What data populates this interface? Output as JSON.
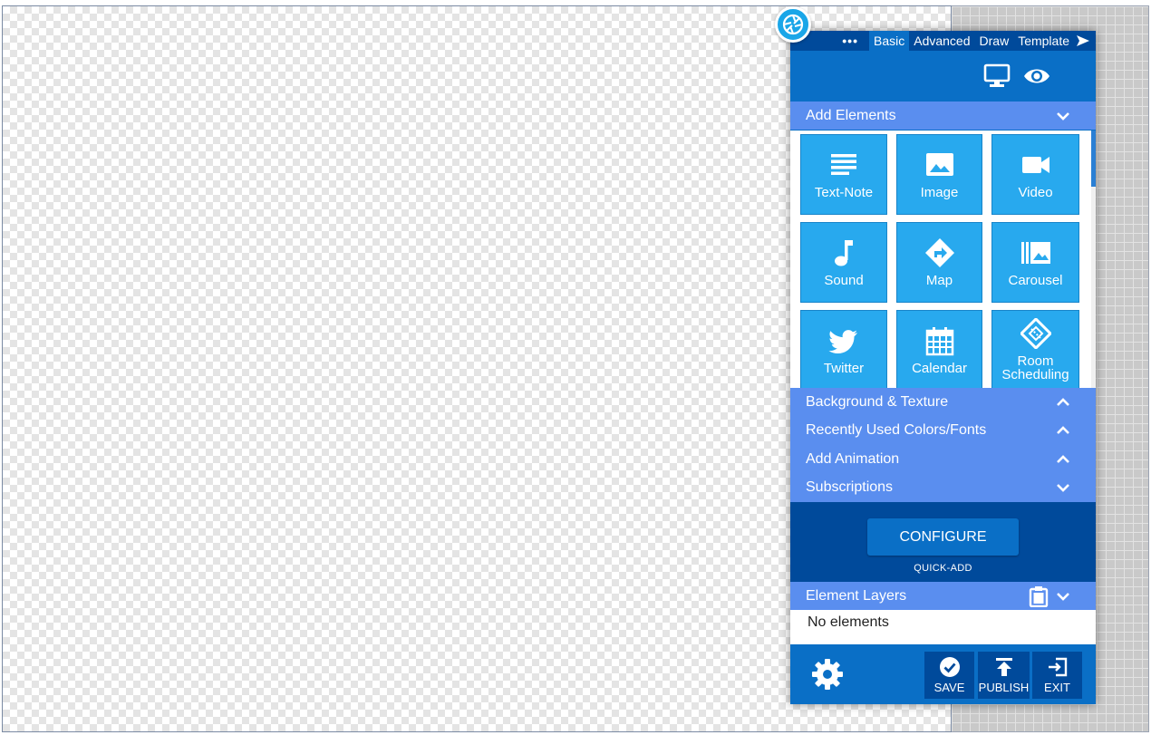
{
  "tabs": {
    "more": "•••",
    "items": [
      "Basic",
      "Advanced",
      "Draw",
      "Template"
    ],
    "active": "Basic"
  },
  "sections": {
    "add_elements": "Add Elements",
    "background": "Background & Texture",
    "recent": "Recently Used Colors/Fonts",
    "animation": "Add Animation",
    "subscriptions": "Subscriptions",
    "layers": "Element Layers"
  },
  "tiles": [
    {
      "label": "Text-Note",
      "icon": "text-note-icon"
    },
    {
      "label": "Image",
      "icon": "image-icon"
    },
    {
      "label": "Video",
      "icon": "video-icon"
    },
    {
      "label": "Sound",
      "icon": "music-note-icon"
    },
    {
      "label": "Map",
      "icon": "directions-icon"
    },
    {
      "label": "Carousel",
      "icon": "carousel-icon"
    },
    {
      "label": "Twitter",
      "icon": "twitter-bird-icon"
    },
    {
      "label": "Calendar",
      "icon": "calendar-icon"
    },
    {
      "label": "Room Scheduling",
      "icon": "ticket-icon"
    }
  ],
  "quick_add": {
    "button": "CONFIGURE",
    "label": "QUICK-ADD"
  },
  "layers": {
    "empty_text": "No elements"
  },
  "actions": {
    "save": "SAVE",
    "publish": "PUBLISH",
    "exit": "EXIT"
  },
  "colors": {
    "panel": "#0a6fc6",
    "dark": "#004a9b",
    "section": "#5a8eef",
    "tile": "#28a9ee"
  }
}
